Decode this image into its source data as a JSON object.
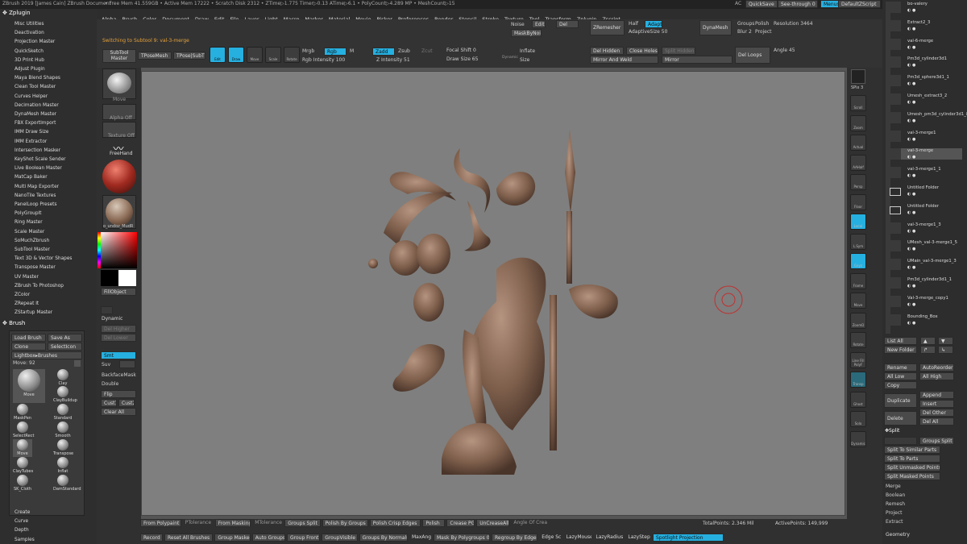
{
  "titlebar": {
    "app": "ZBrush 2019 [James Cain]   ZBrush Document",
    "stats": "• Free Mem 41.559GB • Active Mem 17222 • Scratch Disk 2312 • ZTime▷1.775 Timer▷0.13 ATime▷6.1 • PolyCount▷4.289 MP • MeshCount▷15",
    "ac": "AC",
    "quicksave": "QuickSave",
    "seethrough": "See-through  0",
    "menus": "Menus",
    "defaultscript": "DefaultZScript"
  },
  "left_panel": {
    "header": "Zplugin",
    "items": [
      "Misc Utilities",
      "Deactivation",
      "Projection Master",
      "QuickSketch",
      "3D Print Hub",
      "Adjust Plugin",
      "Maya Blend Shapes",
      "Clean Tool Master",
      "Curves Helper",
      "Decimation Master",
      "DynaMesh Master",
      "FBX ExportImport",
      "IMM Draw Size",
      "IMM Extractor",
      "Intersection Masker",
      "KeyShot Scale Sender",
      "Live Boolean Master",
      "MatCap Baker",
      "Multi Map Exporter",
      "NanoTile Textures",
      "PanelLoop Presets",
      "PolyGroupIt",
      "Ring Master",
      "Scale Master",
      "SoMuchZbrush",
      "SubTool Master",
      "Text 3D & Vector Shapes",
      "Transpose Master",
      "UV Master",
      "ZBrush To Photoshop",
      "ZColor",
      "ZRepeat It",
      "ZStartup Master"
    ],
    "brush_header": "Brush",
    "brush_buttons": {
      "load": "Load Brush",
      "saveas": "Save As",
      "clone": "Clone",
      "selecticon": "SelectIcon",
      "lightbox": "Lightbox▸Brushes"
    },
    "move_label": "Move: 92",
    "brushes": [
      "Move",
      "Clay",
      "ClayBuildup",
      "MaskPen",
      "Standard",
      "SelectRect",
      "Smooth",
      "Move",
      "Transpose",
      "ClayTubes",
      "Inflat",
      "SK_Cloth",
      "DamStandard"
    ],
    "bottom_items": [
      "Create",
      "Curve",
      "Depth",
      "Samples"
    ]
  },
  "menu": [
    "Alpha",
    "Brush",
    "Color",
    "Document",
    "Draw",
    "Edit",
    "File",
    "Layer",
    "Light",
    "Macro",
    "Marker",
    "Material",
    "Movie",
    "Picker",
    "Preferences",
    "Render",
    "Stencil",
    "Stroke",
    "Texture",
    "Tool",
    "Transform",
    "Zplugin",
    "Zscript"
  ],
  "toolbar": {
    "switching": "Switching to Subtool 9:  val-3-merge",
    "subtool_master": "SubTool Master",
    "tposemesh": "TPoseMesh",
    "tposesubt": "TPose|SubT",
    "edit": "Edit",
    "draw": "Draw",
    "move": "Move",
    "scale": "Scale",
    "rotate": "Rotate",
    "mrgb": "Mrgb",
    "rgb": "Rgb",
    "m": "M",
    "rgb_intensity": "Rgb Intensity 100",
    "zadd": "Zadd",
    "zsub": "Zsub",
    "zcut": "Zcut",
    "z_intensity": "Z Intensity 51",
    "focal_shift": "Focal Shift 0",
    "draw_size": "Draw Size 65",
    "dynamic": "Dynamic",
    "noise": "Noise",
    "edit2": "Edit",
    "del": "Del",
    "masknoise": "MaskByNoise",
    "inflate": "Inflate",
    "size": "Size",
    "del_hidden": "Del Hidden",
    "close_holes": "Close Holes",
    "split_hidden": "Split Hidden",
    "mirror_weld": "Mirror And Weld",
    "mirror": "Mirror",
    "del_loops": "Del Loops",
    "angle": "Angle 45",
    "zremesher": "ZRemesher",
    "half": "Half",
    "adapt": "Adapt",
    "adaptive_size": "AdaptiveSize 50",
    "dynamesh": "DynaMesh",
    "groups": "Groups",
    "polish": "Polish",
    "blur": "Blur 2",
    "project": "Project",
    "resolution": "Resolution 3464"
  },
  "left_tray": {
    "move": "Move",
    "alpha_off": "Alpha Off",
    "texture_off": "Texture Off",
    "freehand": "FreeHand",
    "material": "o_undoz_MudR",
    "fillobject": "FillObject",
    "dynamic": "Dynamic",
    "del_higher": "Del Higher",
    "del_lower": "Del Lower",
    "smt": "Smt",
    "suv": "Suv",
    "backfacemask": "BackfaceMask",
    "double": "Double",
    "flip": "Flip",
    "cust1": "Cust1",
    "cust2": "Cust2",
    "clear_all": "Clear All"
  },
  "right_tray": {
    "spix": "SPix 3",
    "items": [
      "Scroll",
      "Zoom",
      "Actual",
      "AAHalf",
      "Persp",
      "Floor",
      "Local",
      "L.Sym",
      "Gxyz",
      "Frame",
      "Move",
      "ZoomD",
      "Rotate",
      "Line Fill PolyF",
      "Transp",
      "Ghost",
      "Solo",
      "Dynamic"
    ]
  },
  "subtools": [
    {
      "name": "bo-valery"
    },
    {
      "name": "Extract2_3"
    },
    {
      "name": "val-6-merge"
    },
    {
      "name": "Pm3d_cylinder3d1"
    },
    {
      "name": "Pm3d_sphere3d1_1"
    },
    {
      "name": "Umesh_extract3_2"
    },
    {
      "name": "Umesh_pm3d_cylinder3d1_8"
    },
    {
      "name": "val-3-merge1"
    },
    {
      "name": "val-3-merge"
    },
    {
      "name": "val-3-merge1_1"
    },
    {
      "name": "Untitled Folder"
    },
    {
      "name": "Untitled Folder"
    },
    {
      "name": "val-3-merge1_3"
    },
    {
      "name": "UMesh_val-3-merge1_5"
    },
    {
      "name": "UMain_val-3-merge1_3"
    },
    {
      "name": "Pm3d_cylinder3d1_1"
    },
    {
      "name": "Val-3-merge_copy1"
    },
    {
      "name": "Bounding_Box"
    }
  ],
  "right_panel": {
    "list_all": "List All",
    "new_folder": "New Folder",
    "rename": "Rename",
    "autoreorder": "AutoReorder",
    "all_low": "All Low",
    "all_high": "All High",
    "copy": "Copy",
    "duplicate": "Duplicate",
    "append": "Append",
    "insert": "Insert",
    "delete": "Delete",
    "del_other": "Del Other",
    "del_all": "Del All",
    "split_header": "Split",
    "groups_split": "Groups Split",
    "split_similar": "Split To Similar Parts",
    "split_parts": "Split To Parts",
    "split_unmasked": "Split Unmasked Points",
    "split_masked": "Split Masked Points",
    "merge": "Merge",
    "boolean": "Boolean",
    "remesh": "Remesh",
    "project": "Project",
    "extract": "Extract",
    "geometry": "Geometry"
  },
  "bottom": {
    "row1": [
      "From Polypaint",
      "PTolerance",
      "From Masking",
      "MTolerance",
      "Groups Split",
      "Polish By Groups",
      "Polish Crisp Edges",
      "Polish",
      "Crease PG",
      "UnCreaseAll",
      "Angle Of Crea"
    ],
    "total_points": "TotalPoints: 2.346 Mil",
    "active_points": "ActivePoints: 149,999",
    "row2": [
      "Record",
      "Reset All Brushes",
      "Group Masked",
      "Auto Groups",
      "Group Front",
      "GroupVisible",
      "Groups By Normals",
      "MaxAng",
      "Mask By Polygroups 0",
      "Regroup By Edges",
      "Edge Sc",
      "LazyMouse",
      "LazyRadius",
      "LazyStep",
      "Spotlight Projection"
    ]
  },
  "colors": {
    "accent": "#26b0e0",
    "model": "#8a6a55",
    "bg_canvas": "#7f7f7f"
  }
}
